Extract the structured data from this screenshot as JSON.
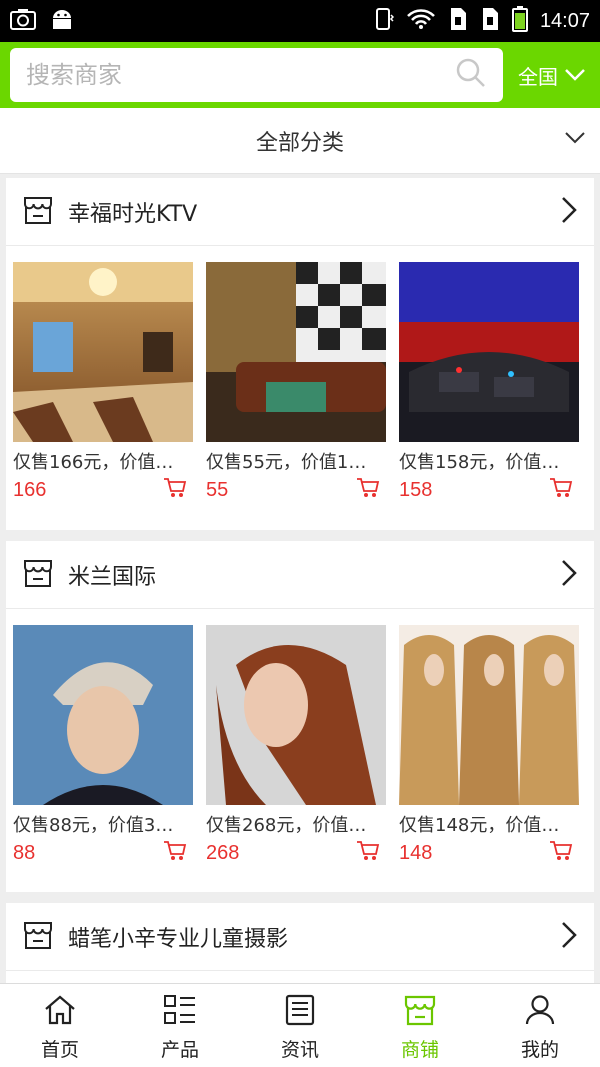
{
  "status_bar": {
    "time": "14:07",
    "icons": [
      "camera-icon",
      "android-icon",
      "vibrate-icon",
      "wifi-icon",
      "sim1-icon",
      "sim2-icon",
      "battery-icon"
    ]
  },
  "header": {
    "search_placeholder": "搜索商家",
    "region_label": "全国",
    "accent_color": "#6bd700"
  },
  "category_bar": {
    "label": "全部分类"
  },
  "shops": [
    {
      "name": "幸福时光KTV",
      "products": [
        {
          "title": "仅售166元，价值…",
          "price": "166",
          "image": "ktv-lobby"
        },
        {
          "title": "仅售55元，价值1…",
          "price": "55",
          "image": "ktv-room-brown"
        },
        {
          "title": "仅售158元，价值…",
          "price": "158",
          "image": "ktv-room-red"
        }
      ]
    },
    {
      "name": "米兰国际",
      "products": [
        {
          "title": "仅售88元，价值3…",
          "price": "88",
          "image": "hairstyle-man"
        },
        {
          "title": "仅售268元，价值…",
          "price": "268",
          "image": "hairstyle-curly"
        },
        {
          "title": "仅售148元，价值…",
          "price": "148",
          "image": "hairstyle-straight"
        }
      ]
    },
    {
      "name": "蜡笔小辛专业儿童摄影",
      "products": []
    }
  ],
  "tab_bar": {
    "tabs": [
      {
        "label": "首页",
        "icon": "home-icon",
        "active": false
      },
      {
        "label": "产品",
        "icon": "list-icon",
        "active": false
      },
      {
        "label": "资讯",
        "icon": "news-icon",
        "active": false
      },
      {
        "label": "商铺",
        "icon": "store-icon",
        "active": true
      },
      {
        "label": "我的",
        "icon": "user-icon",
        "active": false
      }
    ],
    "active_color": "#6bc600"
  },
  "price_color": "#e8312f"
}
